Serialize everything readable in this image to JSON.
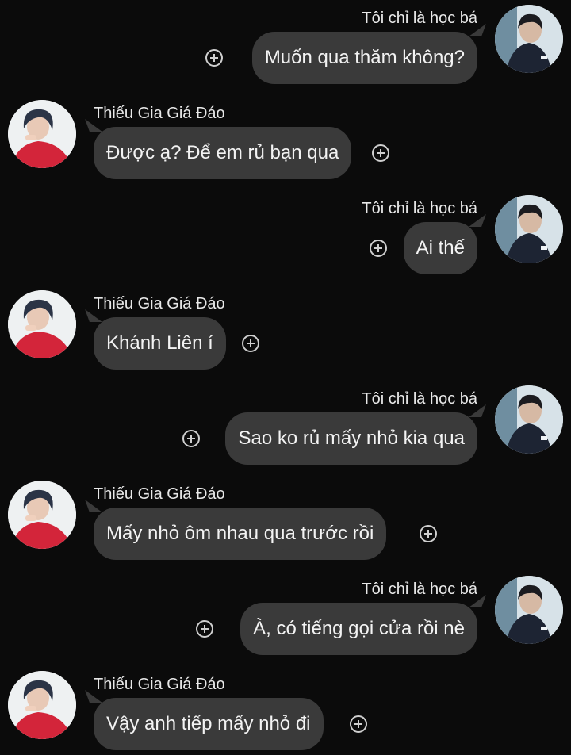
{
  "participants": {
    "me": "Tôi chỉ là học bá",
    "other": "Thiếu Gia Giá Đáo"
  },
  "colors": {
    "background": "#0b0b0b",
    "bubble": "#3a3a3a",
    "text": "#f3f3f3"
  },
  "messages": [
    {
      "sender": "Tôi chỉ là học bá",
      "text": "Muốn qua thăm không?",
      "side": "right"
    },
    {
      "sender": "Thiếu Gia Giá Đáo",
      "text": "Được ạ? Để em rủ bạn qua",
      "side": "left"
    },
    {
      "sender": "Tôi chỉ là học bá",
      "text": "Ai thế",
      "side": "right"
    },
    {
      "sender": "Thiếu Gia Giá Đáo",
      "text": "Khánh Liên í",
      "side": "left"
    },
    {
      "sender": "Tôi chỉ là học bá",
      "text": "Sao ko rủ mấy nhỏ kia qua",
      "side": "right"
    },
    {
      "sender": "Thiếu Gia Giá Đáo",
      "text": "Mấy nhỏ ôm nhau qua trước rồi",
      "side": "left"
    },
    {
      "sender": "Tôi chỉ là học bá",
      "text": "À, có tiếng gọi cửa rồi nè",
      "side": "right"
    },
    {
      "sender": "Thiếu Gia Giá Đáo",
      "text": "Vậy anh tiếp mấy nhỏ đi",
      "side": "left"
    }
  ],
  "icons": {
    "react": "add-reaction-icon",
    "avatar_me": "avatar-dark-suit",
    "avatar_other": "avatar-red-shirt"
  }
}
